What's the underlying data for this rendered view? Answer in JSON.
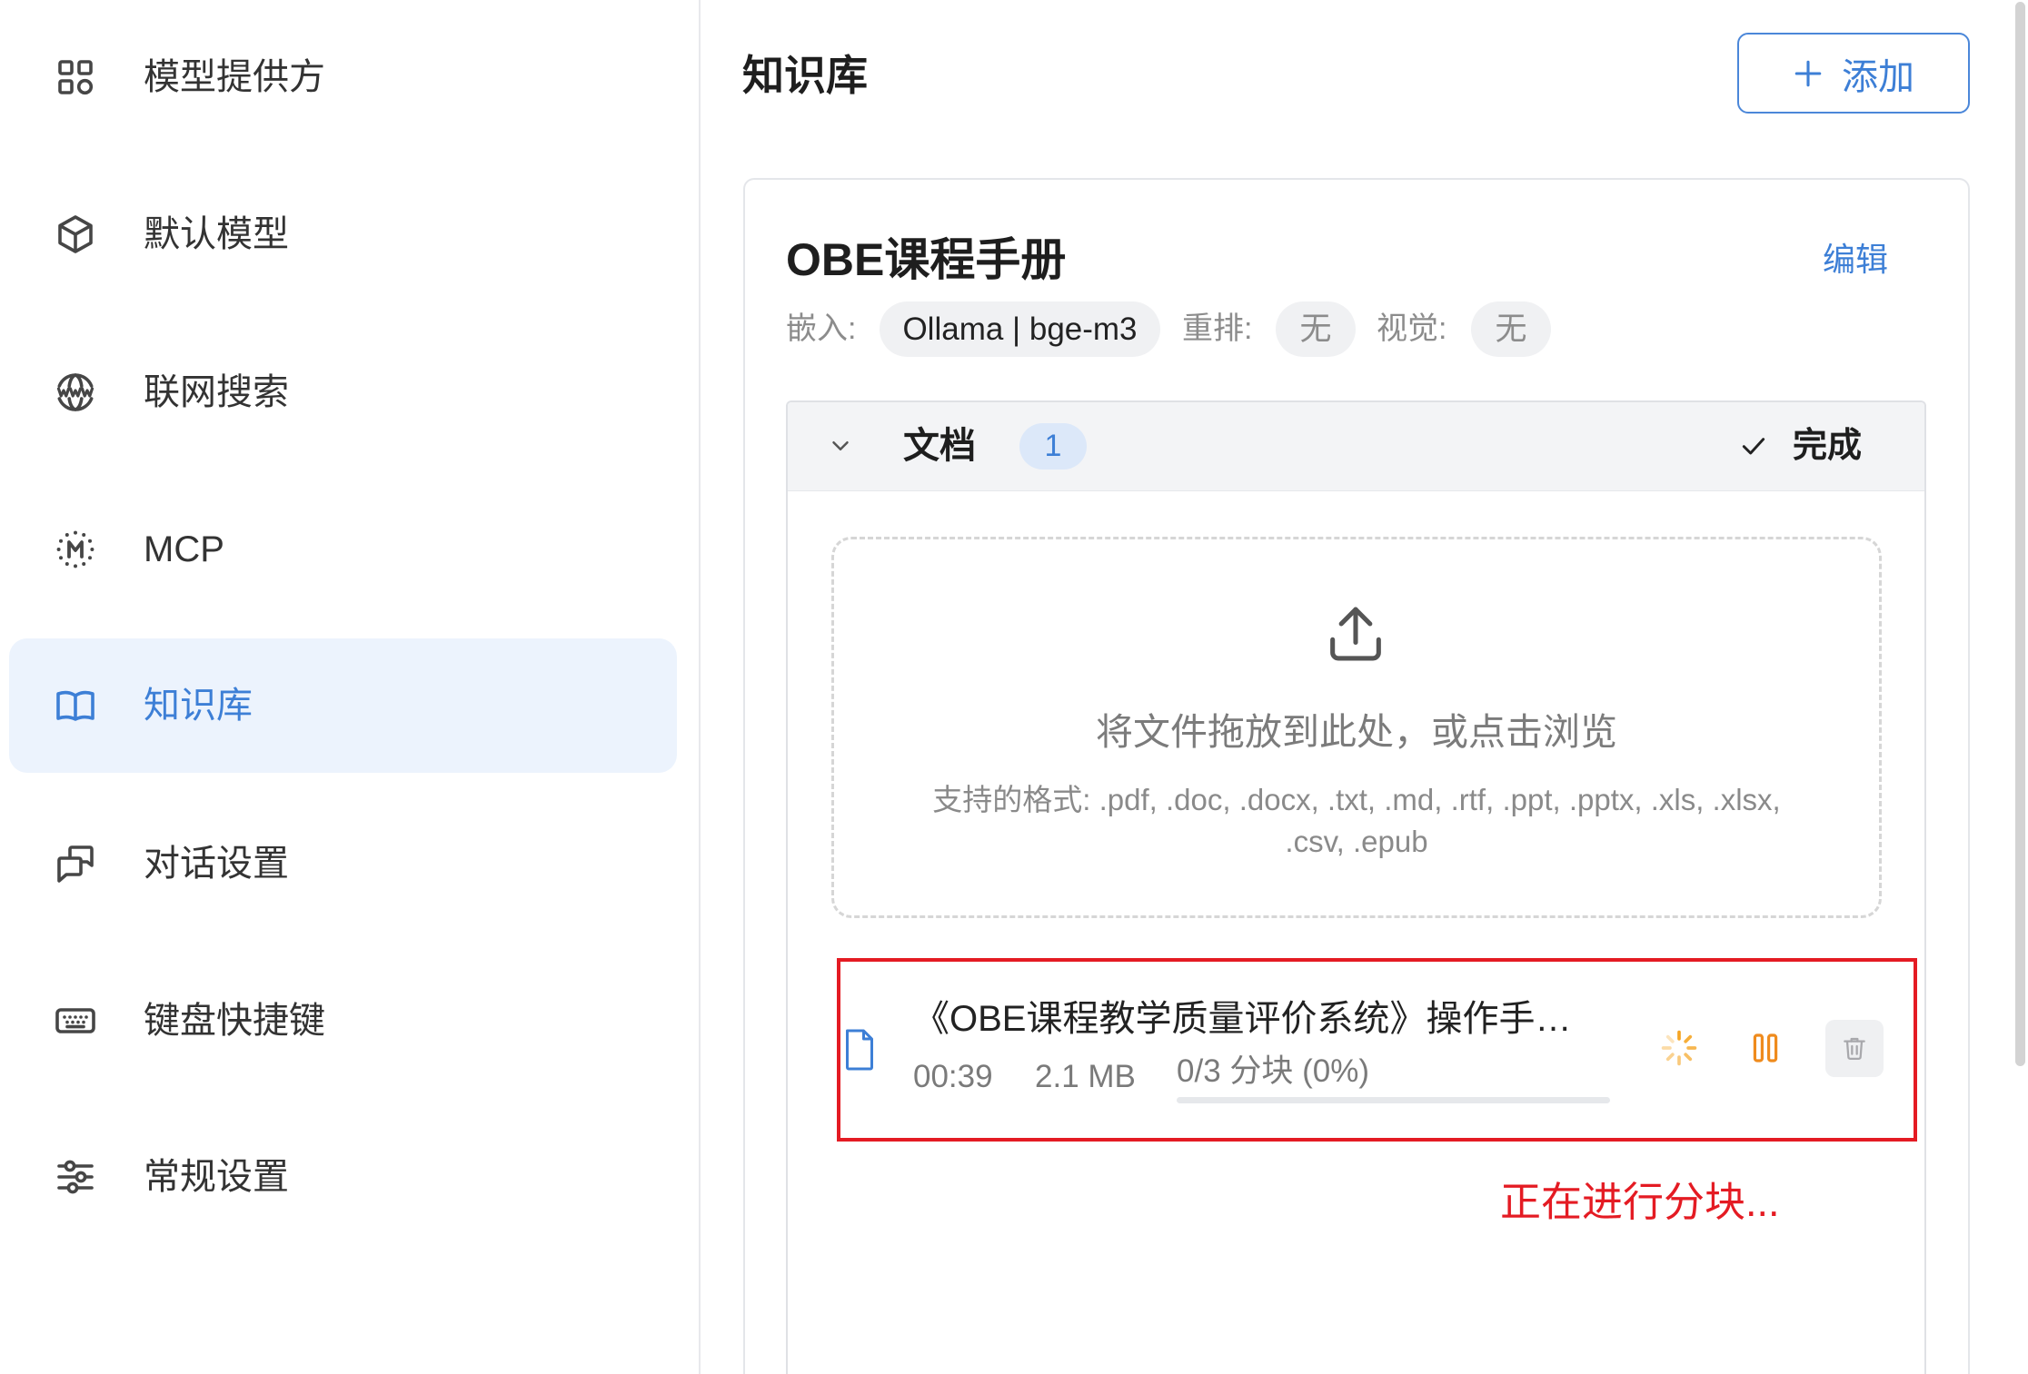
{
  "sidebar": {
    "items": [
      {
        "label": "模型提供方",
        "icon": "grid-icon",
        "active": false
      },
      {
        "label": "默认模型",
        "icon": "cube-icon",
        "active": false
      },
      {
        "label": "联网搜索",
        "icon": "globe-www-icon",
        "active": false
      },
      {
        "label": "MCP",
        "icon": "mcp-icon",
        "active": false
      },
      {
        "label": "知识库",
        "icon": "book-icon",
        "active": true
      },
      {
        "label": "对话设置",
        "icon": "chat-icon",
        "active": false
      },
      {
        "label": "键盘快捷键",
        "icon": "keyboard-icon",
        "active": false
      },
      {
        "label": "常规设置",
        "icon": "sliders-icon",
        "active": false
      }
    ]
  },
  "header": {
    "title": "知识库",
    "add_label": "添加",
    "add_icon": "plus-icon"
  },
  "knowledge_base": {
    "name": "OBE课程手册",
    "edit_label": "编辑",
    "embed_label": "嵌入:",
    "embed_value": "Ollama | bge-m3",
    "rerank_label": "重排:",
    "rerank_value": "无",
    "vision_label": "视觉:",
    "vision_value": "无",
    "documents": {
      "title": "文档",
      "count": "1",
      "done_label": "完成",
      "toggle_icon": "chevron-down-icon",
      "status_icon": "check-icon",
      "dropzone": {
        "icon": "upload-icon",
        "text": "将文件拖放到此处，或点击浏览",
        "formats": "支持的格式: .pdf, .doc, .docx, .txt, .md, .rtf, .ppt, .pptx, .xls, .xlsx, .csv, .epub"
      },
      "files": [
        {
          "icon": "file-icon",
          "name": "《OBE课程教学质量评价系统》操作手…",
          "time": "00:39",
          "size": "2.1 MB",
          "chunks": "0/3 分块 (0%)",
          "progress": 0,
          "status_icon": "spinner-icon",
          "pause_icon": "pause-icon",
          "delete_icon": "trash-icon"
        }
      ]
    }
  },
  "annotation": {
    "text": "正在进行分块..."
  },
  "colors": {
    "accent": "#3d7fd6",
    "active_bg": "#ecf3fd",
    "highlight_red": "#e41b23",
    "spinner_orange": "#f5a524",
    "pause_orange": "#ef8b1d"
  }
}
